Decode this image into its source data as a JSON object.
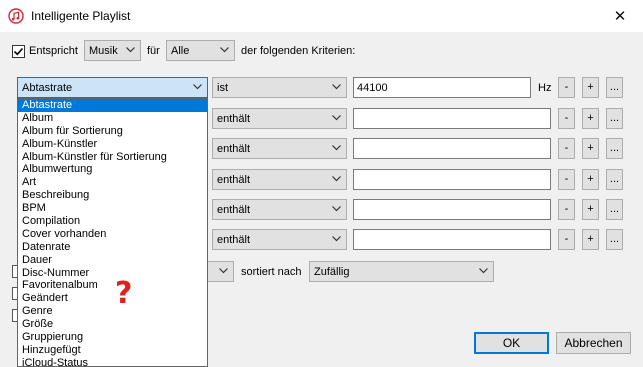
{
  "window": {
    "title": "Intelligente Playlist",
    "close_glyph": "✕"
  },
  "header": {
    "match_label": "Entspricht",
    "media_value": "Musik",
    "fuer_label": "für",
    "scope_value": "Alle",
    "criteria_label": "der folgenden Kriterien:"
  },
  "rules": [
    {
      "field": "Abtastrate",
      "operator": "ist",
      "value": "44100",
      "unit": "Hz"
    },
    {
      "field": "",
      "operator": "enthält",
      "value": "",
      "unit": ""
    },
    {
      "field": "",
      "operator": "enthält",
      "value": "",
      "unit": ""
    },
    {
      "field": "",
      "operator": "enthält",
      "value": "",
      "unit": ""
    },
    {
      "field": "",
      "operator": "enthält",
      "value": "",
      "unit": ""
    },
    {
      "field": "",
      "operator": "enthält",
      "value": "",
      "unit": ""
    }
  ],
  "row_buttons": {
    "minus": "-",
    "plus": "+",
    "more": "..."
  },
  "sort": {
    "label": "sortiert nach",
    "value": "Zufällig"
  },
  "dropdown": {
    "items": [
      "Abtastrate",
      "Album",
      "Album für Sortierung",
      "Album-Künstler",
      "Album-Künstler für Sortierung",
      "Albumwertung",
      "Art",
      "Beschreibung",
      "BPM",
      "Compilation",
      "Cover vorhanden",
      "Datenrate",
      "Dauer",
      "Disc-Nummer",
      "Favoritenalbum",
      "Geändert",
      "Genre",
      "Größe",
      "Gruppierung",
      "Hinzugefügt",
      "iCloud-Status"
    ],
    "selected_index": 0
  },
  "annotation": {
    "text": "?",
    "color": "#e1201c"
  },
  "buttons": {
    "ok": "OK",
    "cancel": "Abbrechen"
  },
  "colors": {
    "accent": "#0078d7",
    "selection_bg": "#cce4f7",
    "dialog_bg": "#f0f0f0"
  },
  "icons": {
    "app": "itunes-note-icon",
    "dropdown_arrow": "chevron-down-icon",
    "checkbox": "checkmark-icon"
  }
}
